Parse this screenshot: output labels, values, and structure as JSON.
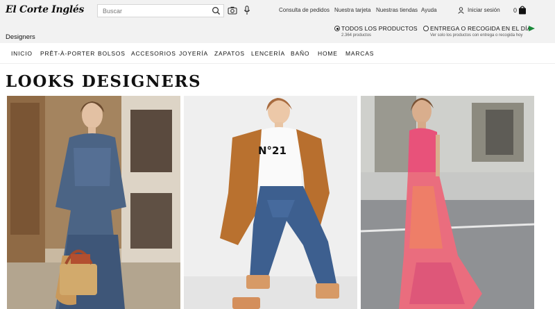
{
  "header": {
    "logo_text": "El Corte Inglés",
    "search": {
      "placeholder": "Buscar"
    },
    "links": [
      "Consulta de pedidos",
      "Nuestra tarjeta",
      "Nuestras tiendas",
      "Ayuda"
    ],
    "login_label": "Iniciar sesión",
    "cart_count": "0"
  },
  "page": {
    "breadcrumb_title": "Designers",
    "heading": "LOOKS DESIGNERS"
  },
  "filters": {
    "all_products": {
      "label": "TODOS LOS PRODUCTOS",
      "count": "2.364 productos",
      "selected": true
    },
    "same_day": {
      "label": "ENTREGA O RECOGIDA EN EL DÍA",
      "description": "Ver solo los productos con entrega o recogida hoy",
      "selected": false
    }
  },
  "nav": {
    "items": [
      "INICIO",
      "PRÊT-À-PORTER",
      "BOLSOS",
      "ACCESORIOS",
      "JOYERÍA",
      "ZAPATOS",
      "LENCERÍA",
      "BAÑO",
      "HOME",
      "MARCAS"
    ]
  },
  "looks": [
    {
      "name": "look-1"
    },
    {
      "name": "look-2",
      "shirt_text": "N°21"
    },
    {
      "name": "look-3"
    }
  ],
  "colors": {
    "topbar_bg": "#f2f2f2",
    "flag": "#1a8a3a"
  }
}
